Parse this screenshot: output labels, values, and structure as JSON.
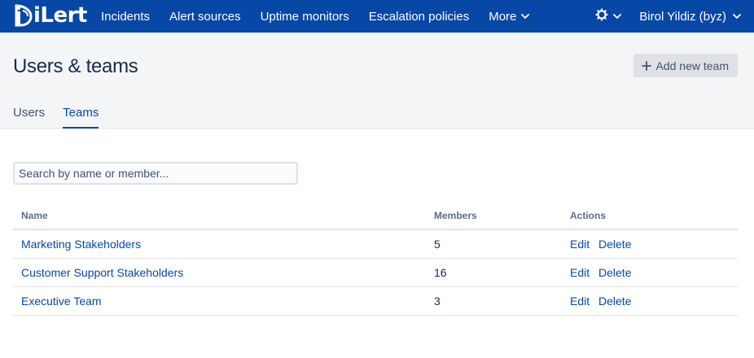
{
  "app": {
    "logo_text": "iLert",
    "brand_color": "#0747a6"
  },
  "nav": {
    "items": [
      {
        "label": "Incidents"
      },
      {
        "label": "Alert sources"
      },
      {
        "label": "Uptime monitors"
      },
      {
        "label": "Escalation policies"
      },
      {
        "label": "More",
        "has_dropdown": true
      }
    ],
    "settings_icon": "gear-icon",
    "user_label": "Birol Yildiz (byz)"
  },
  "header": {
    "title": "Users & teams",
    "add_button_label": "Add new team",
    "add_button_icon": "plus-icon"
  },
  "tabs": [
    {
      "label": "Users",
      "active": false
    },
    {
      "label": "Teams",
      "active": true
    }
  ],
  "search": {
    "placeholder": "Search by name or member...",
    "value": ""
  },
  "table": {
    "columns": [
      "Name",
      "Members",
      "Actions"
    ],
    "rows": [
      {
        "name": "Marketing Stakeholders",
        "members": "5",
        "edit": "Edit",
        "delete": "Delete"
      },
      {
        "name": "Customer Support Stakeholders",
        "members": "16",
        "edit": "Edit",
        "delete": "Delete"
      },
      {
        "name": "Executive Team",
        "members": "3",
        "edit": "Edit",
        "delete": "Delete"
      }
    ]
  }
}
